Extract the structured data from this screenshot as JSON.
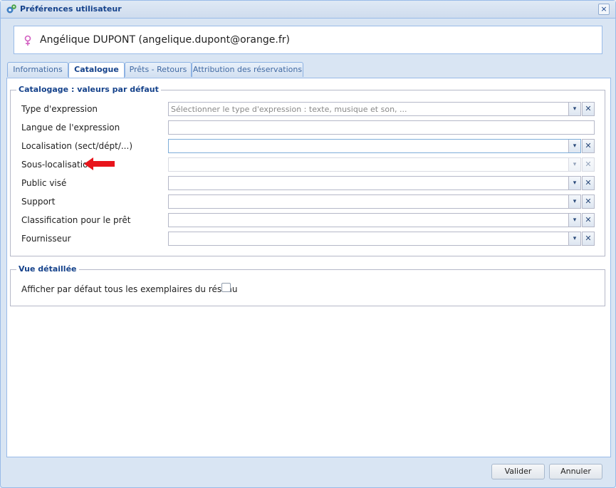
{
  "window": {
    "title": "Préférences utilisateur",
    "close_label": "×"
  },
  "user": {
    "display": "Angélique DUPONT (angelique.dupont@orange.fr)"
  },
  "tabs": [
    {
      "label": "Informations",
      "active": false
    },
    {
      "label": "Catalogue",
      "active": true
    },
    {
      "label": "Prêts - Retours",
      "active": false
    },
    {
      "label": "Attribution des réservations",
      "active": false
    }
  ],
  "catalogage": {
    "legend": "Catalogage : valeurs par défaut",
    "rows": [
      {
        "label": "Type d'expression",
        "kind": "combo",
        "placeholder": "Sélectionner le type d'expression : texte, musique et son, ..."
      },
      {
        "label": "Langue de l'expression",
        "kind": "text",
        "placeholder": ""
      },
      {
        "label": "Localisation (sect/dépt/...)",
        "kind": "combo",
        "placeholder": ""
      },
      {
        "label": "Sous-localisation",
        "kind": "combo-disabled",
        "placeholder": ""
      },
      {
        "label": "Public visé",
        "kind": "combo",
        "placeholder": ""
      },
      {
        "label": "Support",
        "kind": "combo",
        "placeholder": ""
      },
      {
        "label": "Classification pour le prêt",
        "kind": "combo",
        "placeholder": ""
      },
      {
        "label": "Fournisseur",
        "kind": "combo",
        "placeholder": ""
      }
    ]
  },
  "vue_detaillee": {
    "legend": "Vue détaillée",
    "checkbox_label": "Afficher par défaut tous les exemplaires du réseau",
    "checked": false
  },
  "footer": {
    "validate_label": "Valider",
    "cancel_label": "Annuler"
  },
  "icons": {
    "trigger": "▾",
    "clear": "✕",
    "arrow_color": "#e8141b"
  }
}
